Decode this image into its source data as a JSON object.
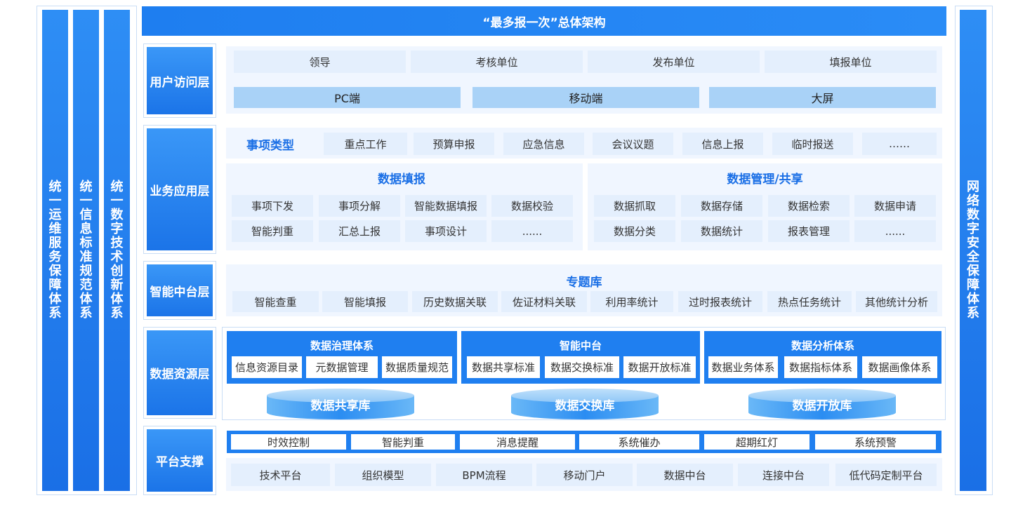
{
  "title": "“最多报一次”总体架构",
  "left_systems": [
    "统一运维服务保障体系",
    "统一信息标准规范体系",
    "统一数字技术创新体系"
  ],
  "right_system": "网络数字安全保障体系",
  "layers": {
    "user": {
      "label": "用户访问层",
      "roles": [
        "领导",
        "考核单位",
        "发布单位",
        "填报单位"
      ],
      "terminals": [
        "PC端",
        "移动端",
        "大屏"
      ]
    },
    "business": {
      "label": "业务应用层",
      "matter_type_label": "事项类型",
      "matter_types": [
        "重点工作",
        "预算申报",
        "应急信息",
        "会议议题",
        "信息上报",
        "临时报送",
        "……"
      ],
      "fill": {
        "title": "数据填报",
        "items": [
          "事项下发",
          "事项分解",
          "智能数据填报",
          "数据校验",
          "智能判重",
          "汇总上报",
          "事项设计",
          "......"
        ]
      },
      "manage": {
        "title": "数据管理/共享",
        "items": [
          "数据抓取",
          "数据存储",
          "数据检索",
          "数据申请",
          "数据分类",
          "数据统计",
          "报表管理",
          "......"
        ]
      }
    },
    "middle": {
      "label": "智能中台层",
      "title": "专题库",
      "items": [
        "智能查重",
        "智能填报",
        "历史数据关联",
        "佐证材料关联",
        "利用率统计",
        "过时报表统计",
        "热点任务统计",
        "其他统计分析"
      ]
    },
    "resource": {
      "label": "数据资源层",
      "groups": [
        {
          "title": "数据治理体系",
          "items": [
            "信息资源目录",
            "元数据管理",
            "数据质量规范"
          ],
          "db": "数据共享库"
        },
        {
          "title": "智能中台",
          "items": [
            "数据共享标准",
            "数据交换标准",
            "数据开放标准"
          ],
          "db": "数据交换库"
        },
        {
          "title": "数据分析体系",
          "items": [
            "数据业务体系",
            "数据指标体系",
            "数据画像体系"
          ],
          "db": "数据开放库"
        }
      ]
    },
    "platform": {
      "label": "平台支撑",
      "top_items": [
        "时效控制",
        "智能判重",
        "消息提醒",
        "系统催办",
        "超期红灯",
        "系统预警"
      ],
      "bottom_items": [
        "技术平台",
        "组织模型",
        "BPM流程",
        "移动门户",
        "数据中台",
        "连接中台",
        "低代码定制平台"
      ]
    }
  }
}
